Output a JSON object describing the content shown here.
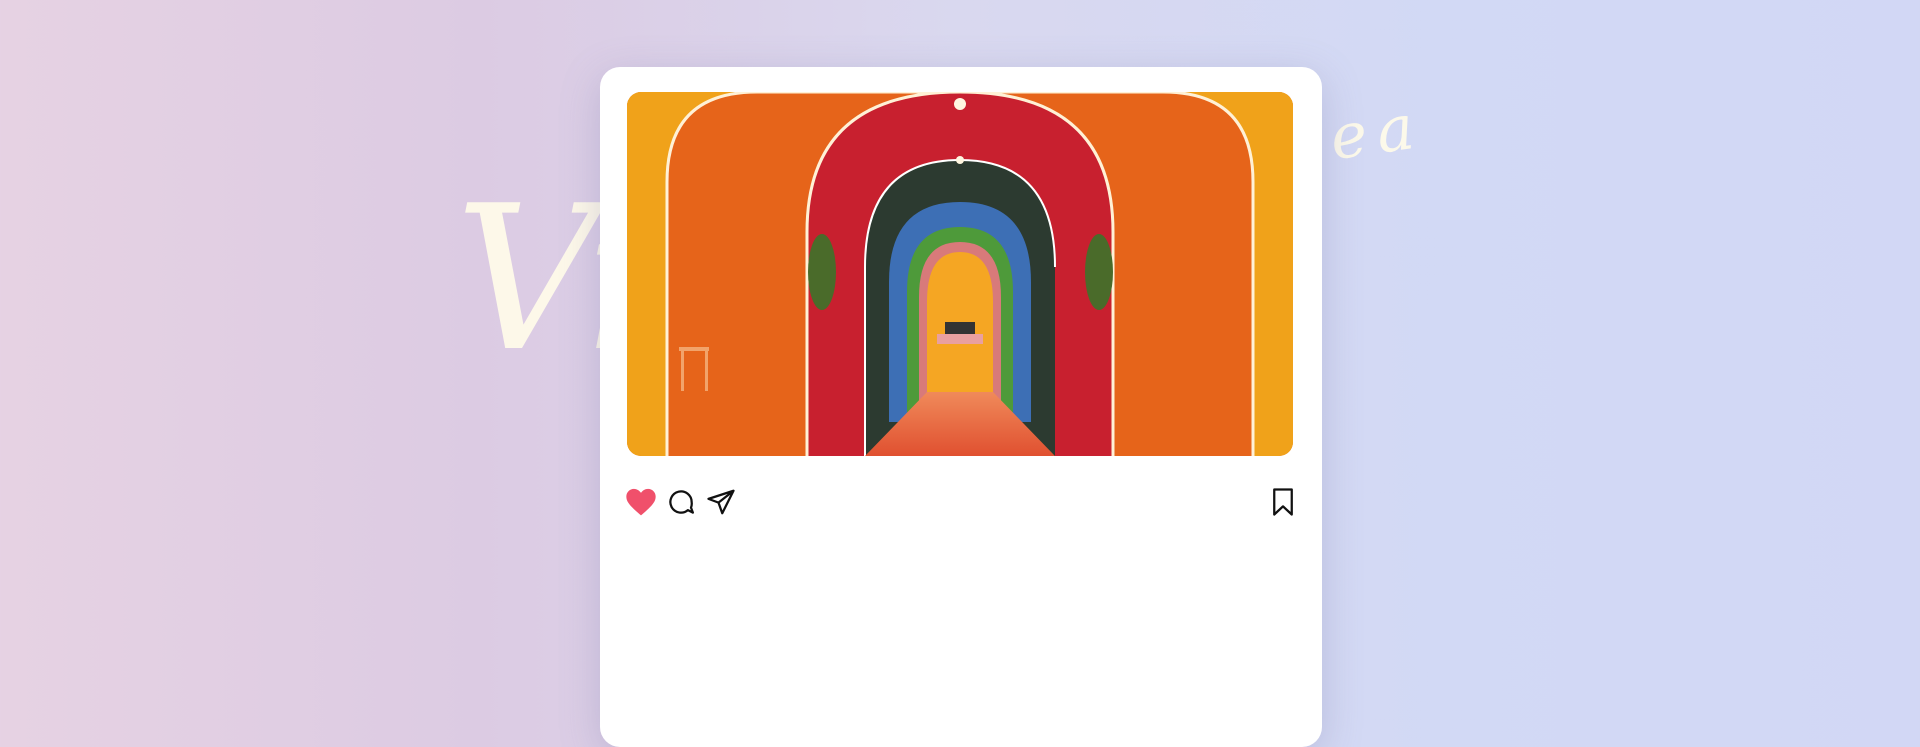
{
  "background_script": {
    "left_text": "Vi",
    "right_text": "ea"
  },
  "post": {
    "image_description": "rainbow-arched-corridor",
    "liked": true,
    "actions": {
      "like_icon": "heart-icon",
      "comment_icon": "comment-icon",
      "share_icon": "send-icon",
      "save_icon": "bookmark-icon"
    }
  },
  "colors": {
    "like": "#f0506b",
    "icon_stroke": "#111111"
  }
}
